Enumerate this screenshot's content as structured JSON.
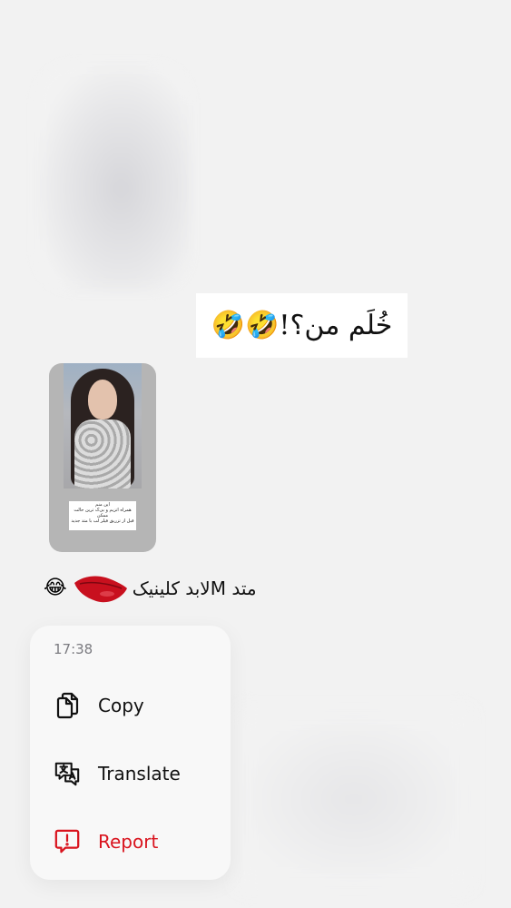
{
  "conversation": {
    "sticker_message": {
      "text": "خُلَم من؟!",
      "emoji": "🤣🤣"
    },
    "story_reply": {
      "caption_lines": [
        "این منم",
        "همراه اتزیم و بی‌ک ترین حالت",
        "ممکن",
        "قبل از تزریق فیلر لب با متد جدید"
      ]
    },
    "text_message": {
      "text": "متد Mلابد کلینیک",
      "emoji": "😂"
    }
  },
  "context_menu": {
    "timestamp": "17:38",
    "items": [
      {
        "label": "Copy",
        "icon": "copy-icon"
      },
      {
        "label": "Translate",
        "icon": "translate-icon"
      },
      {
        "label": "Report",
        "icon": "report-icon",
        "color": "#d9141e"
      }
    ]
  }
}
